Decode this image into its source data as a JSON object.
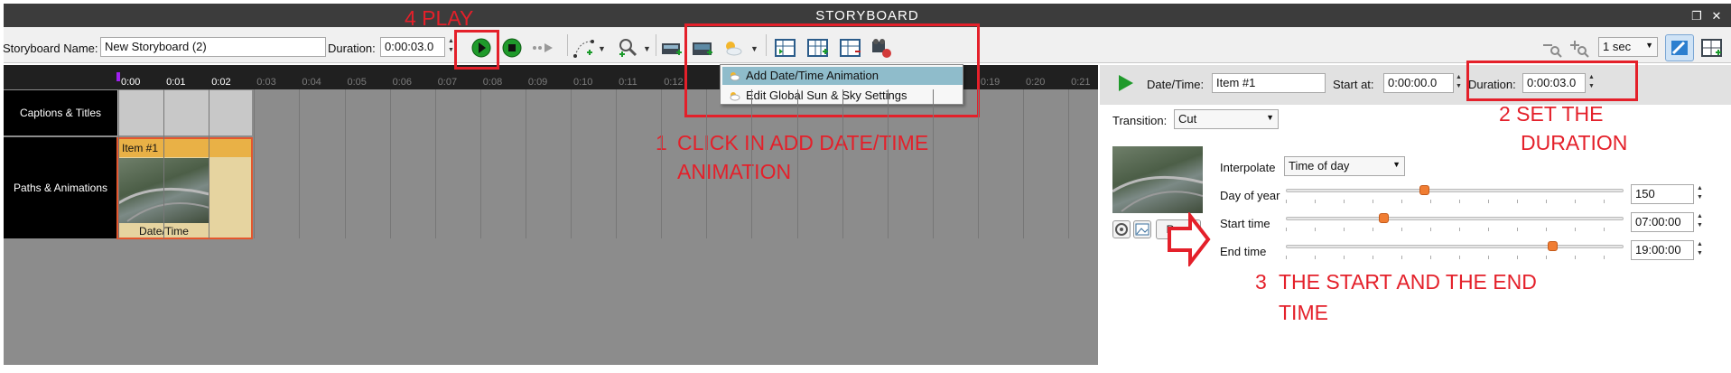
{
  "window": {
    "title": "STORYBOARD",
    "restore_glyph": "❐",
    "close_glyph": "✕"
  },
  "toolbar": {
    "name_label": "Storyboard Name:",
    "name_value": "New Storyboard (2)",
    "duration_label": "Duration:",
    "duration_value": "0:00:03.0",
    "step_value": "1 sec",
    "icons": [
      "play-icon",
      "stop-icon",
      "step-icon",
      "path-icon",
      "zoom-icon",
      "add-camera-icon",
      "add-camera-plus-icon",
      "sun-sky-icon",
      "layout-icon-1",
      "layout-icon-2",
      "layout-icon-3",
      "record-icon",
      "zoom-out-icon",
      "zoom-in-icon",
      "pin-icon",
      "grid-icon"
    ]
  },
  "dropdown_menu": {
    "items": [
      {
        "label": "Add Date/Time Animation",
        "highlighted": true
      },
      {
        "label": "Edit Global Sun & Sky Settings",
        "highlighted": false
      }
    ]
  },
  "timeline": {
    "ticks": [
      "0:00",
      "0:01",
      "0:02",
      "0:03",
      "0:04",
      "0:05",
      "0:06",
      "0:07",
      "0:08",
      "0:09",
      "0:10",
      "0:11",
      "0:12",
      "0:13",
      "0:14",
      "0:15",
      "0:16",
      "0:17",
      "0:18",
      "0:19",
      "0:20",
      "0:21"
    ],
    "visible_ticks_right": [
      "0:19",
      "0:20",
      "0:21"
    ],
    "tracks": [
      {
        "label": "Captions & Titles"
      },
      {
        "label": "Paths & Animations"
      }
    ],
    "item": {
      "title": "Item #1",
      "caption": "Date/Time"
    }
  },
  "inspector": {
    "datetime_label": "Date/Time:",
    "datetime_value": "Item #1",
    "start_label": "Start at:",
    "start_value": "0:00:00.0",
    "duration_label": "Duration:",
    "duration_value": "0:00:03.0",
    "transition_label": "Transition:",
    "transition_value": "Cut",
    "interpolate_label": "Interpolate",
    "interpolate_value": "Time of day",
    "rows": [
      {
        "label": "Day of year",
        "value": "150",
        "level": 0.41
      },
      {
        "label": "Start time",
        "value": "07:00:00",
        "level": 0.29
      },
      {
        "label": "End time",
        "value": "19:00:00",
        "level": 0.79
      }
    ],
    "reset_label": "Reset"
  },
  "annotations": {
    "play": "4 PLAY",
    "step1_num": "1",
    "step1_line1": "CLICK IN ADD DATE/TIME",
    "step1_line2": "ANIMATION",
    "step2_line1": "2 SET THE",
    "step2_line2": "DURATION",
    "step3_num": "3",
    "step3_line1": "THE START AND THE END",
    "step3_line2": "TIME",
    "color": "#e4202a"
  }
}
